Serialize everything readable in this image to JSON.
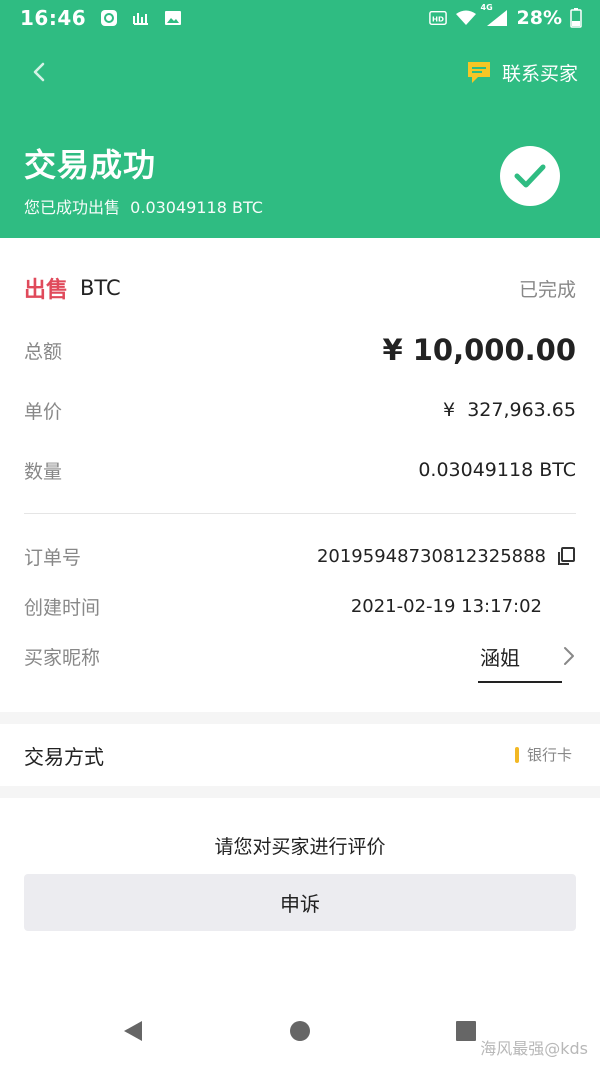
{
  "status_bar": {
    "time": "16:46",
    "network": "4G",
    "battery": "28%",
    "icons": [
      "chat-notification-icon",
      "shan-app-icon",
      "image-icon",
      "hd-icon",
      "wifi-icon",
      "signal-icon",
      "battery-icon"
    ]
  },
  "nav": {
    "contact_label": "联系买家"
  },
  "success": {
    "title": "交易成功",
    "subtitle": "您已成功出售  0.03049118 BTC"
  },
  "order": {
    "side": "出售",
    "coin": "BTC",
    "status": "已完成",
    "total_label": "总额",
    "total_value": "¥ 10,000.00",
    "price_label": "单价",
    "price_value": "¥  327,963.65",
    "qty_label": "数量",
    "qty_value": "0.03049118 BTC",
    "order_no_label": "订单号",
    "order_no_value": "20195948730812325888",
    "created_label": "创建时间",
    "created_value": "2021-02-19 13:17:02",
    "buyer_label": "买家昵称",
    "buyer_value": "涵姐"
  },
  "payment": {
    "label": "交易方式",
    "method": "银行卡"
  },
  "actions": {
    "review_prompt": "请您对买家进行评价",
    "appeal_label": "申诉"
  },
  "watermark": "海风最强@kds",
  "colors": {
    "brand_green": "#2fbc82",
    "sell_red": "#e04a5b",
    "accent_yellow": "#f2b824"
  }
}
